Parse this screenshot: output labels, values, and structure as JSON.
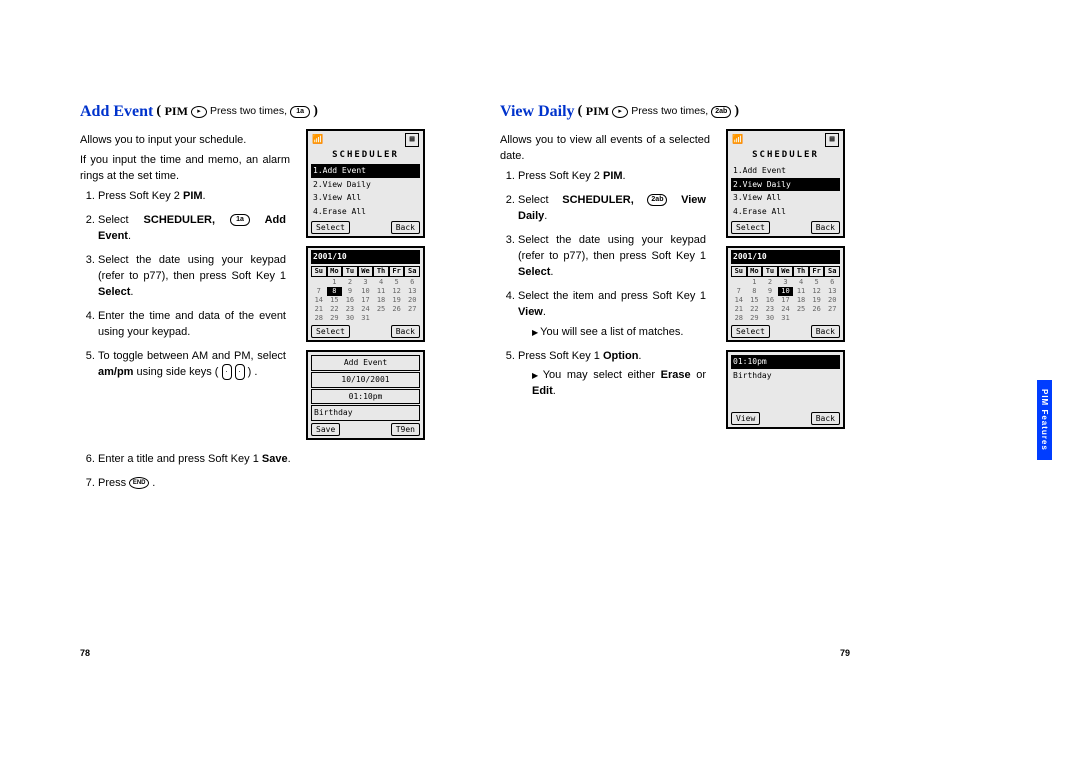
{
  "leftPage": {
    "title": "Add Event",
    "pimLabel": "PIM",
    "pressText": "Press two times,",
    "keyNum": "1a",
    "intro1": "Allows you to input your schedule.",
    "intro2": "If you input the time and memo, an alarm rings at the set time.",
    "steps": {
      "s1_a": "Press Soft Key 2 ",
      "s1_b": "PIM",
      "s2_a": "Select ",
      "s2_b": "SCHEDULER,",
      "s2_key": "1a",
      "s2_c": " Add Event",
      "s3_a": "Select the date using your keypad (refer to p77), then press Soft Key 1 ",
      "s3_b": "Select",
      "s4": "Enter the time and data of the event using your keypad.",
      "s5_a": "To toggle between AM and PM, select ",
      "s5_b": "am/pm",
      "s5_c": " using side keys",
      "s6_a": "Enter a title and press Soft Key 1 ",
      "s6_b": "Save",
      "s7": "Press "
    },
    "pageNum": "78"
  },
  "rightPage": {
    "title": "View Daily",
    "pimLabel": "PIM",
    "pressText": "Press two times,",
    "keyNum": "2ab",
    "intro1": "Allows you to view all events of a selected date.",
    "steps": {
      "s1_a": "Press Soft Key 2 ",
      "s1_b": "PIM",
      "s2_a": "Select ",
      "s2_b": "SCHEDULER,",
      "s2_key": "2ab",
      "s2_c": " View Daily",
      "s3_a": "Select the date using your keypad (refer to p77), then press Soft Key 1 ",
      "s3_b": "Select",
      "s4_a": "Select the item and press Soft Key 1 ",
      "s4_b": "View",
      "s4_sub": "You will see a list of matches.",
      "s5_a": "Press Soft Key 1 ",
      "s5_b": "Option",
      "s5_sub_a": "You may select either ",
      "s5_sub_b": "Erase",
      "s5_sub_c": " or ",
      "s5_sub_d": "Edit"
    },
    "pageNum": "79"
  },
  "sideTab": "PIM Features",
  "screens": {
    "schedTitle": "SCHEDULER",
    "menu1": [
      "1.Add Event",
      "2.View Daily",
      "3.View All",
      "4.Erase All"
    ],
    "menu2": [
      "1.Add Event",
      "2.View Daily",
      "3.View All",
      "4.Erase All"
    ],
    "selectBtn": "Select",
    "backBtn": "Back",
    "saveBtn": "Save",
    "t9Btn": "T9en",
    "viewBtn": "View",
    "calTitle": "2001/10",
    "days": [
      "Su",
      "Mo",
      "Tu",
      "We",
      "Th",
      "Fr",
      "Sa"
    ],
    "calCells": [
      "",
      "1",
      "2",
      "3",
      "4",
      "5",
      "6",
      "7",
      "8",
      "9",
      "10",
      "11",
      "12",
      "13",
      "14",
      "15",
      "16",
      "17",
      "18",
      "19",
      "20",
      "21",
      "22",
      "23",
      "24",
      "25",
      "26",
      "27",
      "28",
      "29",
      "30",
      "31",
      "",
      "",
      "",
      ""
    ],
    "addEventTitle": "Add Event",
    "addEventDate": "10/10/2001",
    "addEventTime": "01:10pm",
    "addEventNote": "Birthday",
    "viewTime": "01:10pm",
    "viewNote": "Birthday"
  }
}
